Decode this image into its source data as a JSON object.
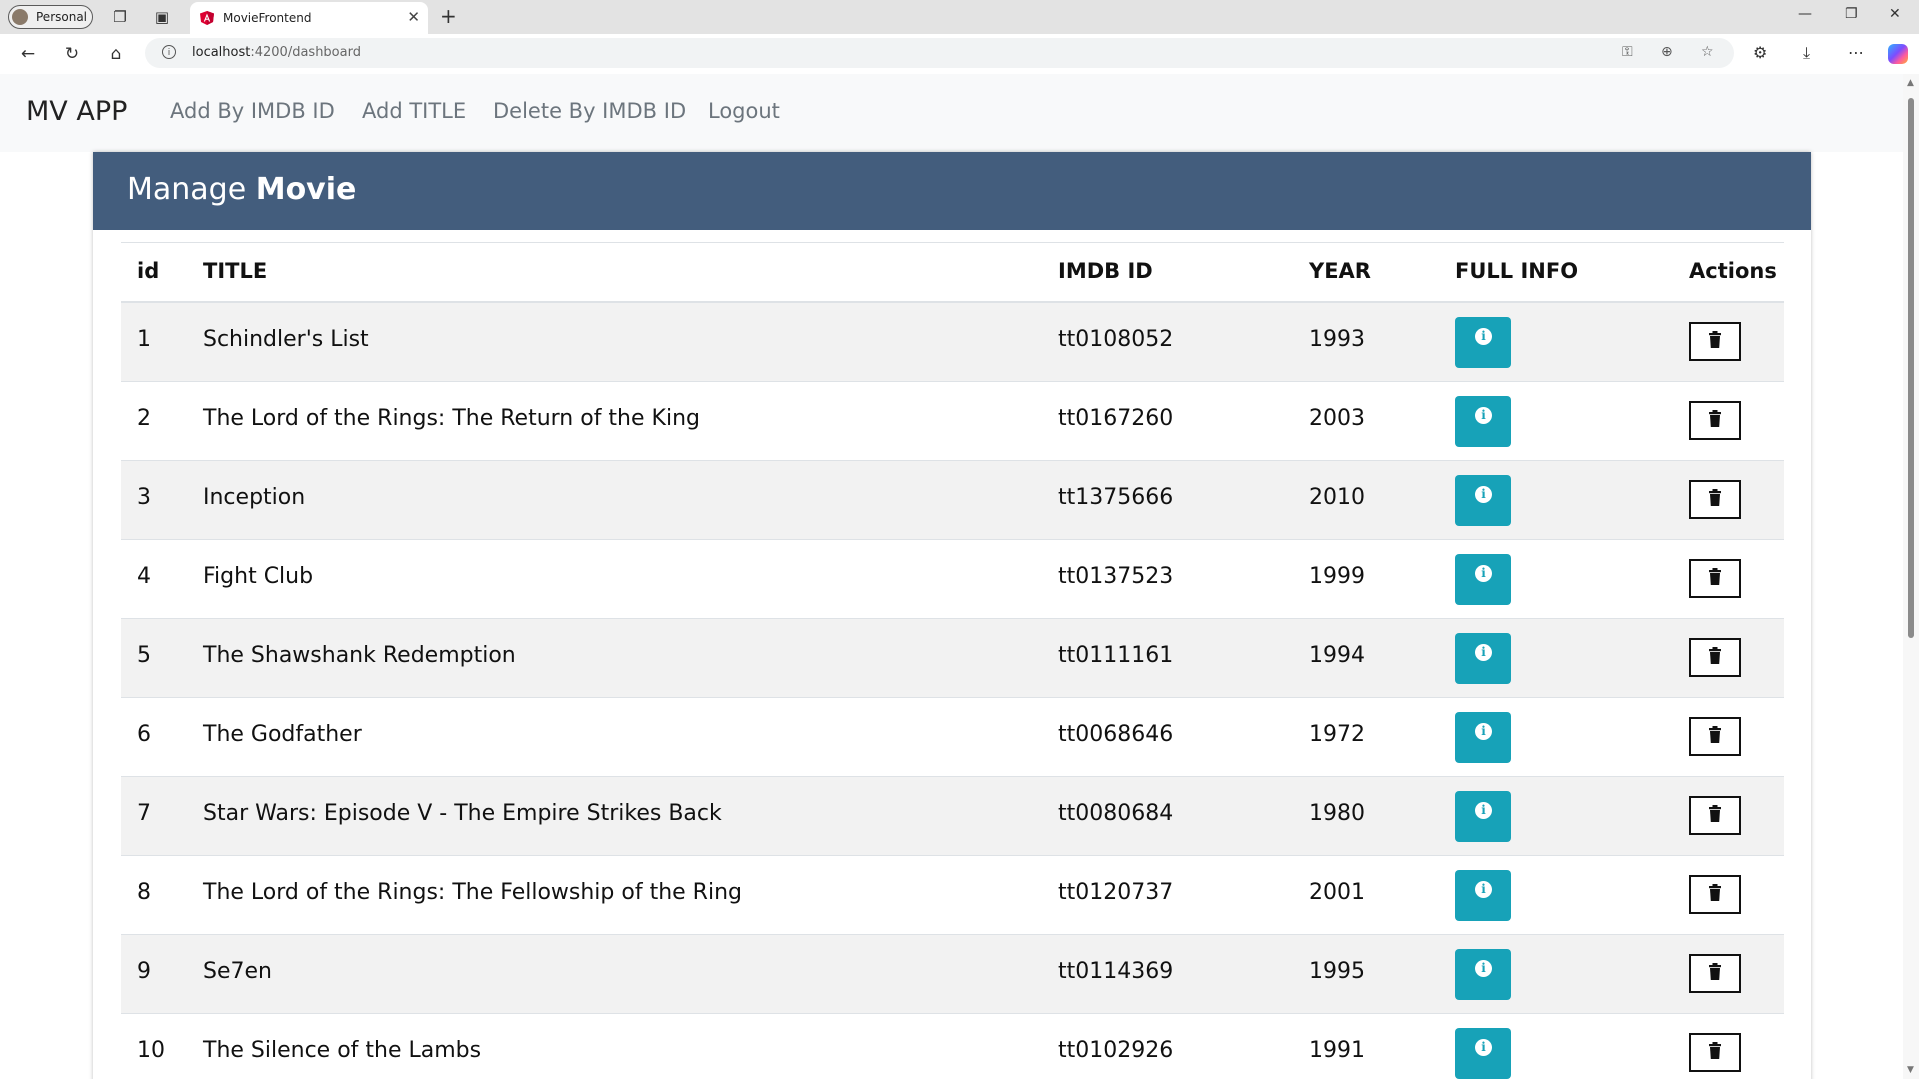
{
  "browser": {
    "profile_label": "Personal",
    "tab_title": "MovieFrontend",
    "url_host": "localhost",
    "url_path": ":4200/dashboard",
    "accent_color": "#dd0031"
  },
  "navbar": {
    "brand": "MV APP",
    "links": [
      "Add By IMDB ID",
      "Add TITLE",
      "Delete By IMDB ID",
      "Logout"
    ]
  },
  "header": {
    "title_regular": "Manage",
    "title_bold": "Movie",
    "background_color": "#435d7d"
  },
  "table": {
    "columns": [
      "id",
      "TITLE",
      "IMDB ID",
      "YEAR",
      "FULL INFO",
      "Actions"
    ],
    "rows": [
      {
        "id": "1",
        "title": "Schindler's List",
        "imdb_id": "tt0108052",
        "year": "1993"
      },
      {
        "id": "2",
        "title": "The Lord of the Rings: The Return of the King",
        "imdb_id": "tt0167260",
        "year": "2003"
      },
      {
        "id": "3",
        "title": "Inception",
        "imdb_id": "tt1375666",
        "year": "2010"
      },
      {
        "id": "4",
        "title": "Fight Club",
        "imdb_id": "tt0137523",
        "year": "1999"
      },
      {
        "id": "5",
        "title": "The Shawshank Redemption",
        "imdb_id": "tt0111161",
        "year": "1994"
      },
      {
        "id": "6",
        "title": "The Godfather",
        "imdb_id": "tt0068646",
        "year": "1972"
      },
      {
        "id": "7",
        "title": "Star Wars: Episode V - The Empire Strikes Back",
        "imdb_id": "tt0080684",
        "year": "1980"
      },
      {
        "id": "8",
        "title": "The Lord of the Rings: The Fellowship of the Ring",
        "imdb_id": "tt0120737",
        "year": "2001"
      },
      {
        "id": "9",
        "title": "Se7en",
        "imdb_id": "tt0114369",
        "year": "1995"
      },
      {
        "id": "10",
        "title": "The Silence of the Lambs",
        "imdb_id": "tt0102926",
        "year": "1991"
      }
    ],
    "info_button_icon": "info-circle-icon",
    "info_button_color": "#17a2b8",
    "delete_button_icon": "trash-icon"
  }
}
